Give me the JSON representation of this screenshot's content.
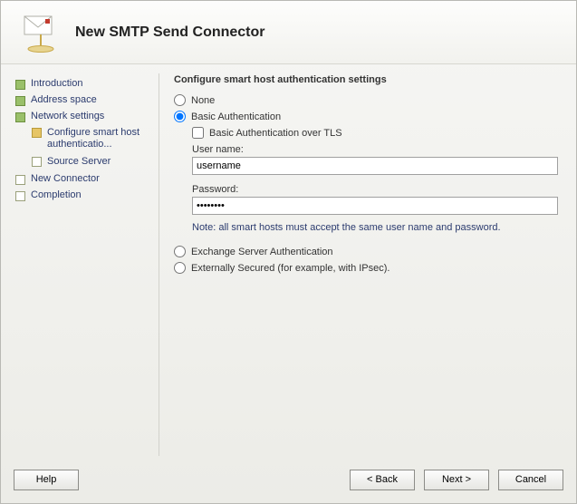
{
  "header": {
    "title": "New SMTP Send Connector"
  },
  "sidebar": {
    "items": [
      {
        "label": "Introduction"
      },
      {
        "label": "Address space"
      },
      {
        "label": "Network settings"
      },
      {
        "label": "New Connector"
      },
      {
        "label": "Completion"
      }
    ],
    "sub_items": [
      {
        "label": "Configure smart host authenticatio..."
      },
      {
        "label": "Source Server"
      }
    ]
  },
  "content": {
    "section_title": "Configure smart host authentication settings",
    "radio_none": "None",
    "radio_basic": "Basic Authentication",
    "check_tls": "Basic Authentication over TLS",
    "username_label": "User name:",
    "username_value": "username",
    "password_label": "Password:",
    "password_value": "••••••••",
    "note": "Note: all smart hosts must accept the same user name and password.",
    "radio_exchange": "Exchange Server Authentication",
    "radio_external": "Externally Secured (for example, with IPsec)."
  },
  "footer": {
    "help": "Help",
    "back": "< Back",
    "next": "Next >",
    "cancel": "Cancel"
  }
}
